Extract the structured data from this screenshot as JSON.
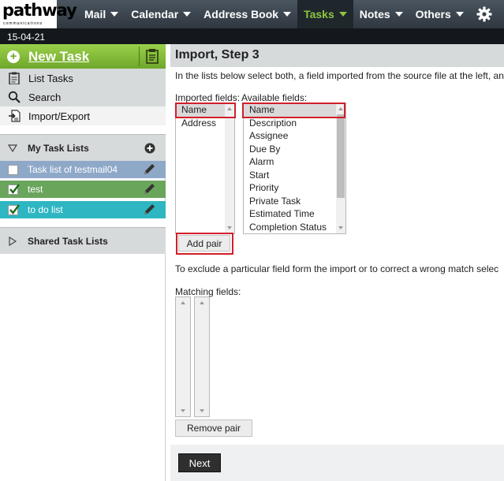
{
  "brand": {
    "name": "pathway",
    "subtitle": "communications"
  },
  "nav": {
    "items": [
      {
        "label": "Mail"
      },
      {
        "label": "Calendar"
      },
      {
        "label": "Address Book"
      },
      {
        "label": "Tasks",
        "active": true
      },
      {
        "label": "Notes"
      },
      {
        "label": "Others"
      }
    ],
    "settings_icon": "gear-icon"
  },
  "date": "15-04-21",
  "sidebar": {
    "new_task": "New Task",
    "menu": [
      {
        "label": "List Tasks",
        "icon": "clipboard-icon"
      },
      {
        "label": "Search",
        "icon": "search-icon"
      },
      {
        "label": "Import/Export",
        "icon": "import-export-icon"
      }
    ],
    "my_task_lists": "My Task Lists",
    "task_lists": [
      {
        "label": "Task list of testmail04",
        "color": "#8ea8c8",
        "checked": false
      },
      {
        "label": "test",
        "color": "#6aa55c",
        "checked": true
      },
      {
        "label": "to do list",
        "color": "#2eb6c2",
        "checked": true
      }
    ],
    "shared_task_lists": "Shared Task Lists"
  },
  "main": {
    "title": "Import, Step 3",
    "intro": "In the lists below select both, a field imported from the source file at the left, an",
    "imported_label": "Imported fields:",
    "available_label": "Available fields:",
    "imported_fields": [
      "Name",
      "Address"
    ],
    "available_fields": [
      "Name",
      "Description",
      "Assignee",
      "Due By",
      "Alarm",
      "Start",
      "Priority",
      "Private Task",
      "Estimated Time",
      "Completion Status"
    ],
    "add_pair": "Add pair",
    "exclude_text": "To exclude a particular field form the import or to correct a wrong match selec",
    "matching_label": "Matching fields:",
    "remove_pair": "Remove pair",
    "next": "Next"
  }
}
